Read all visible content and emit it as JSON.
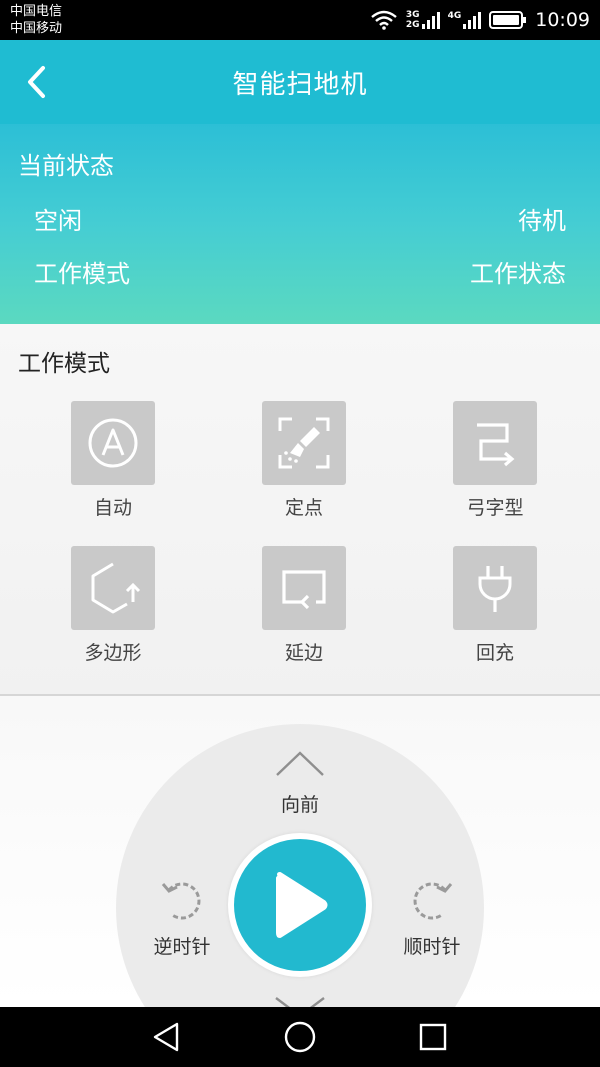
{
  "status_bar": {
    "carrier_1": "中国电信",
    "carrier_2": "中国移动",
    "net_1_top": "3G",
    "net_1_bottom": "2G",
    "net_2": "4G",
    "time": "10:09"
  },
  "header": {
    "title": "智能扫地机",
    "back_icon": "chevron-left-icon"
  },
  "current_status": {
    "title": "当前状态",
    "mode_value": "空闲",
    "state_value": "待机",
    "mode_label": "工作模式",
    "state_label": "工作状态"
  },
  "work_modes": {
    "title": "工作模式",
    "items": [
      {
        "label": "自动",
        "icon": "auto-a-icon"
      },
      {
        "label": "定点",
        "icon": "spot-clean-icon"
      },
      {
        "label": "弓字型",
        "icon": "zigzag-icon"
      },
      {
        "label": "多边形",
        "icon": "polygon-icon"
      },
      {
        "label": "延边",
        "icon": "edge-clean-icon"
      },
      {
        "label": "回充",
        "icon": "charge-plug-icon"
      }
    ]
  },
  "controls": {
    "forward_label": "向前",
    "ccw_label": "逆时针",
    "cw_label": "顺时针",
    "play_icon": "play-icon"
  },
  "colors": {
    "accent": "#1fbcd2",
    "status_gradient_end": "#5bd9c0",
    "tile_gray": "#c9c9c9"
  }
}
